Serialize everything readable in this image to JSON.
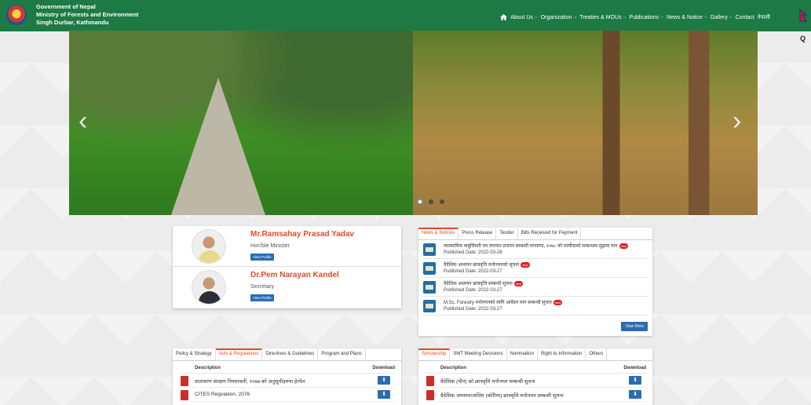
{
  "header": {
    "line1": "Government of Nepal",
    "line2": "Ministry of Forests and Environment",
    "line3": "Singh Durbar, Kathmandu",
    "nav": [
      {
        "label": "About Us",
        "dropdown": true
      },
      {
        "label": "Organization",
        "dropdown": true
      },
      {
        "label": "Treaties & MOUs",
        "dropdown": true
      },
      {
        "label": "Publications",
        "dropdown": true
      },
      {
        "label": "News & Notice",
        "dropdown": true
      },
      {
        "label": "Gallery",
        "dropdown": true
      },
      {
        "label": "Contact",
        "dropdown": false
      },
      {
        "label": "नेपाली",
        "dropdown": false
      }
    ],
    "brand_color": "#1d7a45"
  },
  "slider": {
    "prev_glyph": "‹",
    "next_glyph": "›",
    "dots": 3,
    "active_dot": 0
  },
  "officials": [
    {
      "name": "Mr.Ramsahay Prasad Yadav",
      "role": "Hon'ble Minister",
      "button": "View Profile"
    },
    {
      "name": "Dr.Pem Narayan Kandel",
      "role": "Secretary",
      "button": "View Profile"
    }
  ],
  "news": {
    "tabs": [
      "News & Notices",
      "Press Release",
      "Tender",
      "Bills Received for Payment"
    ],
    "items": [
      {
        "title": "व्यवसायिक कबुलियती वन लगायत प्रजनन सम्बन्धी मापदण्ड, २०७८ को मस्यौदाको सम्बन्धमा सुझाव माग",
        "date": "Published Date: 2022-03-28",
        "badge": "new"
      },
      {
        "title": "वैदेशिक अध्ययन छात्रवृत्ति मनोनयनको सूचना",
        "date": "Published Date: 2022-03-27",
        "badge": "new"
      },
      {
        "title": "वैदेशिक अध्ययन छात्रवृत्ति सम्बन्धी सूचना",
        "date": "Published Date: 2022-03-27",
        "badge": "new"
      },
      {
        "title": "M.Sc. Forestry मनोनयनको लागि आवेदन माग सम्बन्धी सूचना",
        "date": "Published Date: 2022-03-27",
        "badge": "new"
      }
    ],
    "view_more": "View More"
  },
  "acts": {
    "tabs": [
      "Policy & Strategy",
      "Acts & Regulations",
      "Directives & Guidelines",
      "Program and Plans"
    ],
    "col_desc": "Description",
    "col_download": "Download",
    "rows": [
      {
        "title": "वातावरण संरक्षण नियमावली, २०७७ को अनुसूचीहरुमा हेरफेर"
      },
      {
        "title": "CITES Regulation, 2076"
      }
    ]
  },
  "scholar": {
    "tabs": [
      "Scholarship",
      "SMT Meeting Decisions",
      "Nomination",
      "Right to Information",
      "Others"
    ],
    "col_desc": "Description",
    "col_download": "Download",
    "rows": [
      {
        "title": "वैदेशिक (चीन) को छात्रवृत्ति मनोनयन सम्बन्धी सूचना"
      },
      {
        "title": "वैदेशिक अध्ययन/तालिम (कोरिया) छात्रवृत्ति मनोनयन सम्बन्धी सूचना"
      }
    ]
  }
}
